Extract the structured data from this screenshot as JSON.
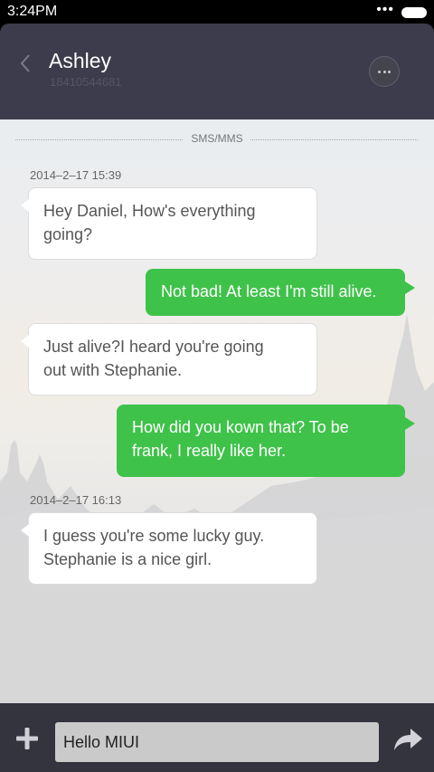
{
  "status_bar": {
    "time": "3:24PM",
    "dots": "•••",
    "icons": [
      "signal-dots-icon",
      "battery-icon"
    ]
  },
  "header": {
    "contact_name": "Ashley",
    "contact_number": "18410544681",
    "icons": [
      "chevron-left-icon",
      "more-icon"
    ]
  },
  "conversation": {
    "channel_label": "SMS/MMS",
    "timestamps": [
      "2014–2–17 15:39",
      "2014–2–17 16:13"
    ],
    "messages": [
      {
        "direction": "incoming",
        "lines": [
          "Hey Daniel, How's everything",
          "going?"
        ]
      },
      {
        "direction": "outgoing",
        "lines": [
          "Not bad! At least I'm still alive."
        ]
      },
      {
        "direction": "incoming",
        "lines": [
          "Just  alive?I heard you're going",
          "out with Stephanie."
        ]
      },
      {
        "direction": "outgoing",
        "lines": [
          "How did you kown that? To be",
          "frank, I really like her."
        ]
      },
      {
        "direction": "incoming",
        "lines": [
          "I guess you're some lucky guy.",
          "Stephanie is a nice girl."
        ]
      }
    ]
  },
  "composer": {
    "value": "Hello MIUI",
    "icons": [
      "plus-icon",
      "send-arrow-icon"
    ]
  },
  "colors": {
    "header_bg": "#3c3c4c",
    "outgoing_bubble": "#3fc24a",
    "incoming_bubble": "#ffffff",
    "compose_bar": "#34343f"
  }
}
